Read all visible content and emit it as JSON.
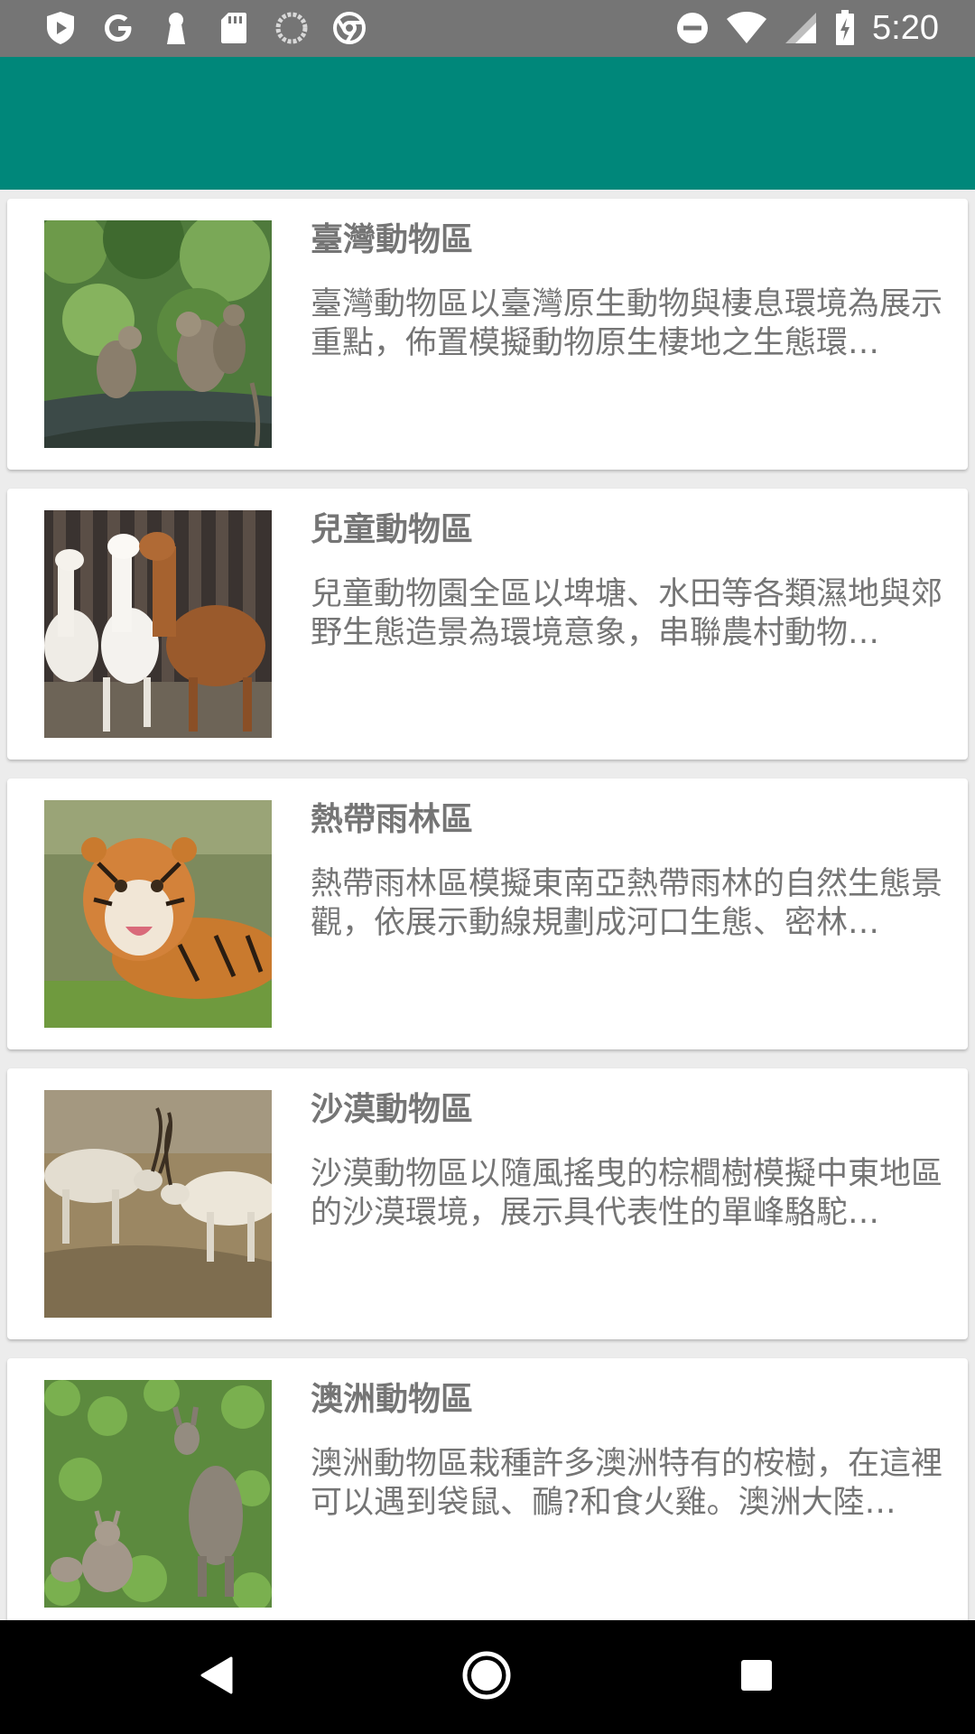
{
  "status_bar": {
    "time": "5:20",
    "left_icons": [
      "play-protect-icon",
      "google-icon",
      "keyhole-icon",
      "sd-card-icon",
      "sync-circle-icon",
      "chrome-icon"
    ],
    "right_icons": [
      "do-not-disturb-icon",
      "wifi-icon",
      "cell-signal-icon",
      "battery-charging-icon"
    ]
  },
  "app_bar": {
    "color": "#00877a"
  },
  "zones": [
    {
      "title": "臺灣動物區",
      "description": "臺灣動物區以臺灣原生動物與棲息環境為展示重點，佈置模擬動物原生棲地之生態環…",
      "image": "monkeys-on-log"
    },
    {
      "title": "兒童動物區",
      "description": "兒童動物園全區以埤塘、水田等各類濕地與郊野生態造景為環境意象，串聯農村動物…",
      "image": "alpacas"
    },
    {
      "title": "熱帶雨林區",
      "description": "熱帶雨林區模擬東南亞熱帶雨林的自然生態景觀，依展示動線規劃成河口生態、密林…",
      "image": "tiger"
    },
    {
      "title": "沙漠動物區",
      "description": "沙漠動物區以隨風搖曳的棕櫚樹模擬中東地區的沙漠環境，展示具代表性的單峰駱駝…",
      "image": "addax-antelopes"
    },
    {
      "title": "澳洲動物區",
      "description": "澳洲動物區栽種許多澳洲特有的桉樹，在這裡可以遇到袋鼠、鴯?和食火雞。澳洲大陸…",
      "image": "kangaroos"
    }
  ],
  "nav_bar": {
    "back_icon": "back-triangle-icon",
    "home_icon": "home-circle-icon",
    "recents_icon": "recents-square-icon"
  }
}
